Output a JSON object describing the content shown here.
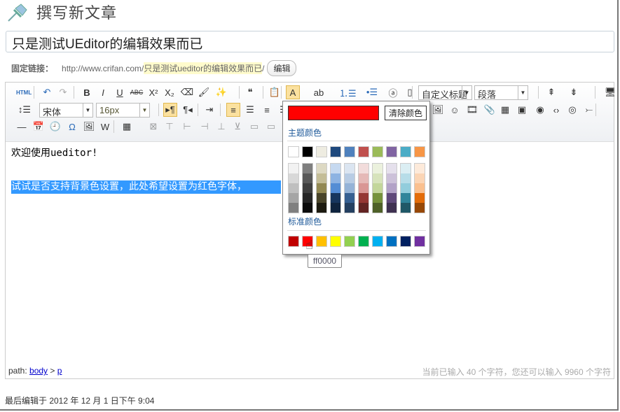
{
  "page": {
    "title": "撰写新文章",
    "post_title": "只是测试UEditor的编辑效果而已"
  },
  "permalink": {
    "label": "固定链接：",
    "base": "http://www.crifan.com/",
    "slug": "只是测试ueditor的编辑效果而已",
    "trail": "/",
    "edit": "编辑"
  },
  "toolbar": {
    "row1": [
      [
        "html-source-button",
        "HTML",
        15
      ],
      [
        "undo-button",
        "↶",
        49
      ],
      [
        "redo-button",
        "↷",
        72
      ],
      [
        "bold-button",
        "B",
        106
      ],
      [
        "italic-button",
        "I",
        129
      ],
      [
        "underline-button",
        "U",
        153
      ],
      [
        "strikethrough-button",
        "ABC",
        177
      ],
      [
        "superscript-button",
        "X²",
        201
      ],
      [
        "subscript-button",
        "X₂",
        224
      ],
      [
        "eraser-icon",
        "⌫",
        249
      ],
      [
        "format-brush-icon",
        "🖌",
        273
      ],
      [
        "auto-format-icon",
        "✨",
        298
      ],
      [
        "blockquote-button",
        "❝",
        339
      ],
      [
        "paste-plain-button",
        "📋",
        374
      ],
      [
        "font-color-button",
        "A",
        400
      ],
      [
        "background-color-button",
        "ab",
        437
      ],
      [
        "ordered-list-button",
        "⒈☰",
        476
      ],
      [
        "unordered-list-button",
        "•☰",
        513
      ],
      [
        "char-border-button",
        "ⓐ",
        543
      ],
      [
        "new-page-button",
        "▯",
        567
      ],
      [
        "line-above-button",
        "⇞",
        769
      ],
      [
        "line-below-button",
        "⇟",
        801
      ],
      [
        "preview-button",
        "🖥",
        853
      ]
    ],
    "row2": [
      [
        "row-spacing-button",
        "↕☰",
        17
      ],
      [
        "ltr-button",
        "▸¶",
        225
      ],
      [
        "rtl-button",
        "¶◂",
        250
      ],
      [
        "indent-button",
        "⇥",
        281
      ],
      [
        "align-left-button",
        "≡",
        315
      ],
      [
        "align-center-button",
        "☰",
        339
      ],
      [
        "align-right-button",
        "≡",
        363
      ],
      [
        "justify-button",
        "☰",
        387
      ],
      [
        "insert-image-button",
        "🖼",
        607
      ],
      [
        "emoticon-button",
        "☺",
        631
      ],
      [
        "video-button",
        "🎞",
        656
      ],
      [
        "attachment-button",
        "📎",
        681
      ],
      [
        "map-button",
        "▦",
        703
      ],
      [
        "google-map-button",
        "▣",
        727
      ],
      [
        "web-image-button",
        "◉",
        753
      ],
      [
        "code-button",
        "‹›",
        776
      ],
      [
        "iframe-button",
        "◎",
        799
      ],
      [
        "pagebreak-button",
        "⤚",
        823
      ]
    ],
    "row3": [
      [
        "horizontal-rule-button",
        "—",
        13
      ],
      [
        "date-button",
        "📅",
        37
      ],
      [
        "time-button",
        "🕘",
        61
      ],
      [
        "special-char-button",
        "Ω",
        85
      ],
      [
        "scrawl-button",
        "🖼",
        109
      ],
      [
        "word-image-button",
        "W",
        132
      ],
      [
        "table-button",
        "▦",
        163
      ],
      [
        "delete-table-button",
        "⊠",
        201
      ],
      [
        "insert-paragraph-before-table-button",
        "⊤",
        224
      ],
      [
        "insert-row-button",
        "⊢",
        249
      ],
      [
        "delete-row-button",
        "⊣",
        274
      ],
      [
        "insert-col-button",
        "⊥",
        298
      ],
      [
        "delete-col-button",
        "⊻",
        321
      ],
      [
        "merge-cells-button",
        "▭",
        345
      ],
      [
        "merge-right-button",
        "▭",
        369
      ]
    ],
    "custom_heading": "自定义标题",
    "paragraph": "段落",
    "font_family": "宋体",
    "font_size": "16px"
  },
  "content": {
    "line1_cn": "欢迎使用",
    "line1_en": "ueditor!",
    "selected": "试试是否支持背景色设置，此处希望设置为红色字体，"
  },
  "footer": {
    "path_label": "path: ",
    "path_body": "body",
    "path_sep": " > ",
    "path_p": "p",
    "count": "当前已输入 40 个字符，您还可以输入 9960 个字符"
  },
  "last_edit": "最后编辑于 2012 年 12 月 1 日下午 9:04",
  "color_picker": {
    "selected_color": "#ff0000",
    "clear": "清除颜色",
    "theme_label": "主题颜色",
    "standard_label": "标准颜色",
    "tooltip": "ff0000",
    "theme": [
      "#ffffff",
      "#000000",
      "#eeece1",
      "#1f497d",
      "#4f81bd",
      "#c0504d",
      "#9bbb59",
      "#8064a2",
      "#4bacc6",
      "#f79646"
    ],
    "shades": [
      [
        "#f2f2f2",
        "#d8d8d8",
        "#bfbfbf",
        "#a5a5a5",
        "#7f7f7f"
      ],
      [
        "#7f7f7f",
        "#595959",
        "#3f3f3f",
        "#262626",
        "#0c0c0c"
      ],
      [
        "#ddd9c3",
        "#c4bd97",
        "#938953",
        "#494429",
        "#1d1b10"
      ],
      [
        "#c6d9f0",
        "#8db3e2",
        "#548dd4",
        "#17365d",
        "#0f243e"
      ],
      [
        "#dbe5f1",
        "#b8cce4",
        "#95b3d7",
        "#366092",
        "#244061"
      ],
      [
        "#f2dcdb",
        "#e5b9b7",
        "#d99694",
        "#953734",
        "#632423"
      ],
      [
        "#ebf1dd",
        "#d7e3bc",
        "#c3d69b",
        "#76923c",
        "#4f6128"
      ],
      [
        "#e5e0ec",
        "#ccc1d9",
        "#b2a2c7",
        "#5f497a",
        "#3f3151"
      ],
      [
        "#dbeef3",
        "#b7dde8",
        "#92cddc",
        "#31859b",
        "#205867"
      ],
      [
        "#fdeada",
        "#fbd5b5",
        "#fac08f",
        "#e36c09",
        "#974806"
      ]
    ],
    "standard": [
      "#c00000",
      "#ff0000",
      "#ffc000",
      "#ffff00",
      "#92d050",
      "#00b050",
      "#00b0f0",
      "#0070c0",
      "#002060",
      "#7030a0"
    ]
  }
}
